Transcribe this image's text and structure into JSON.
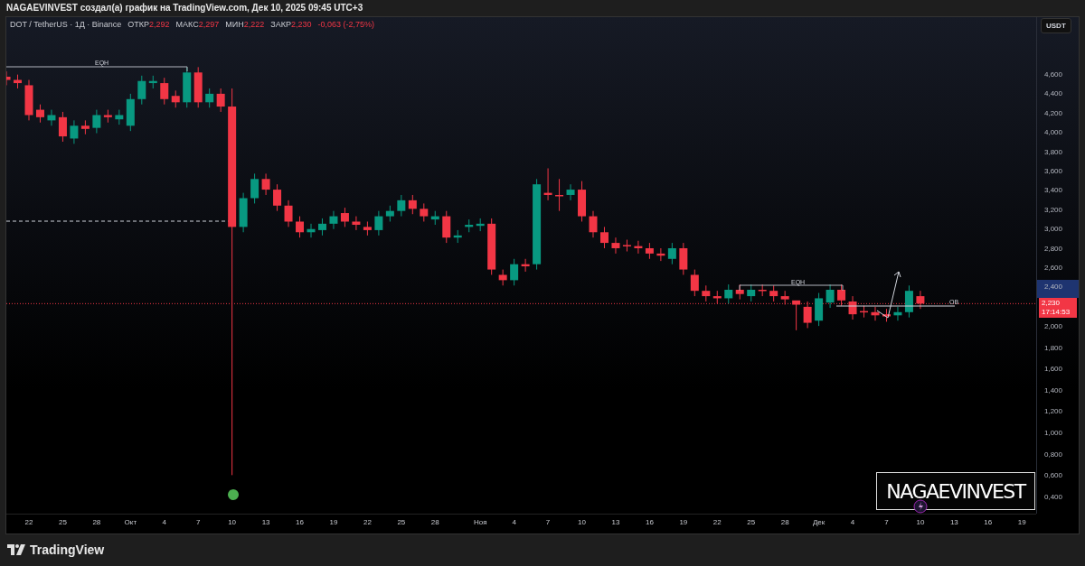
{
  "header": {
    "title": "NAGAEVINVEST создал(а) график на TradingView.com, Дек 10, 2025 09:45 UTC+3"
  },
  "legend": {
    "symbol": "DOT / TetherUS · 1Д · Binance",
    "ohlc": [
      {
        "label": "ОТКР",
        "value": "2,292"
      },
      {
        "label": "МАКС",
        "value": "2,297"
      },
      {
        "label": "МИН",
        "value": "2,222"
      },
      {
        "label": "ЗАКР",
        "value": "2,230"
      }
    ],
    "change": "-0,063 (-2,75%)"
  },
  "currency_button": "USDT",
  "price_axis": [
    "4,600",
    "4,400",
    "4,200",
    "4,000",
    "3,800",
    "3,600",
    "3,400",
    "3,200",
    "3,000",
    "2,800",
    "2,600",
    "2,400",
    "2,000",
    "1,800",
    "1,600",
    "1,400",
    "1,200",
    "1,000",
    "0,800",
    "0,600",
    "0,400"
  ],
  "last_price": {
    "price": "2,230",
    "countdown": "17:14:53"
  },
  "date_axis": [
    "22",
    "25",
    "28",
    "Окт",
    "4",
    "7",
    "10",
    "13",
    "16",
    "19",
    "22",
    "25",
    "28",
    "Ноя",
    "4",
    "7",
    "10",
    "13",
    "16",
    "19",
    "22",
    "25",
    "28",
    "Дек",
    "4",
    "7",
    "10",
    "13",
    "16",
    "19"
  ],
  "annotations": [
    {
      "text": "EQH"
    },
    {
      "text": "EQH"
    },
    {
      "text": "OB"
    }
  ],
  "author_badge": "NAGAEVINVEST",
  "footer": {
    "brand": "TradingView"
  }
}
